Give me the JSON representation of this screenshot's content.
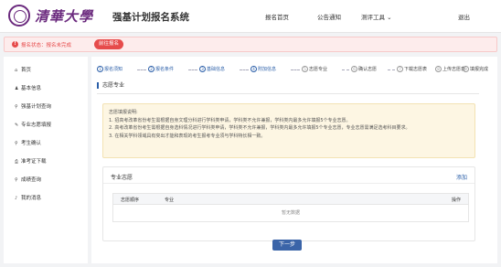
{
  "header": {
    "logo_text": "清華大學",
    "system_title": "强基计划报名系统",
    "nav": {
      "home": "报名首页",
      "notice": "公告通知",
      "tools": "测评工具 ⌄",
      "logout": "退出"
    }
  },
  "banner": {
    "icon": "!",
    "text": "报名状态：报名未完成",
    "button": "前往报名"
  },
  "sidebar": {
    "items": [
      {
        "label": "首页",
        "icon": "home-icon",
        "glyph": "⌂"
      },
      {
        "label": "基本信息",
        "icon": "user-icon",
        "glyph": "♟"
      },
      {
        "label": "强基计划查询",
        "icon": "search-icon",
        "glyph": "⚲"
      },
      {
        "label": "专业志愿填报",
        "icon": "edit-icon",
        "glyph": "✎"
      },
      {
        "label": "考生确认",
        "icon": "search-icon",
        "glyph": "⚲"
      },
      {
        "label": "准考证下载",
        "icon": "print-icon",
        "glyph": "⎙"
      },
      {
        "label": "成绩查询",
        "icon": "search-icon",
        "glyph": "⚲"
      },
      {
        "label": "我的消息",
        "icon": "bell-icon",
        "glyph": "♪"
      }
    ]
  },
  "steps": [
    {
      "num": "1",
      "label": "报名须知",
      "state": "done"
    },
    {
      "num": "2",
      "label": "报名条件",
      "state": "done"
    },
    {
      "num": "3",
      "label": "基础信息",
      "state": "done"
    },
    {
      "num": "4",
      "label": "附加信息",
      "state": "done"
    },
    {
      "num": "5",
      "label": "志愿专业",
      "state": "todo"
    },
    {
      "num": "6",
      "label": "确认志愿",
      "state": "todo"
    },
    {
      "num": "7",
      "label": "下载志愿表",
      "state": "todo"
    },
    {
      "num": "8",
      "label": "上传志愿表",
      "state": "todo"
    },
    {
      "num": "9",
      "label": "填报完成",
      "state": "todo"
    }
  ],
  "main": {
    "section_title": "志愿专业",
    "notes": [
      "志愿填报说明:",
      "1. 招高考改革省份考生需根据自身文理分科进行学科类申请，学科类不允许兼报，学科类内最多允许填报5个专业志愿。",
      "2. 高考改革省份考生需根据自身选科情况进行学科类申请，学科类不允许兼报，学科类内最多允许填报5个专业志愿，专业志愿需满足选考科目要求。",
      "3. 在相关学科领域具有突出才能和表现的考生报考专业须与学科特长相一致。"
    ],
    "major_title": "专业志愿",
    "add_label": "添加",
    "table": {
      "headers": [
        "志愿顺序",
        "专业",
        "操作"
      ],
      "empty_text": "暂无数据"
    },
    "next_button": "下一步"
  },
  "colors": {
    "primary": "#2a5ea8",
    "danger": "#e64b4b",
    "brand": "#6b2a7e",
    "notice_bg": "#fdf6e3"
  }
}
